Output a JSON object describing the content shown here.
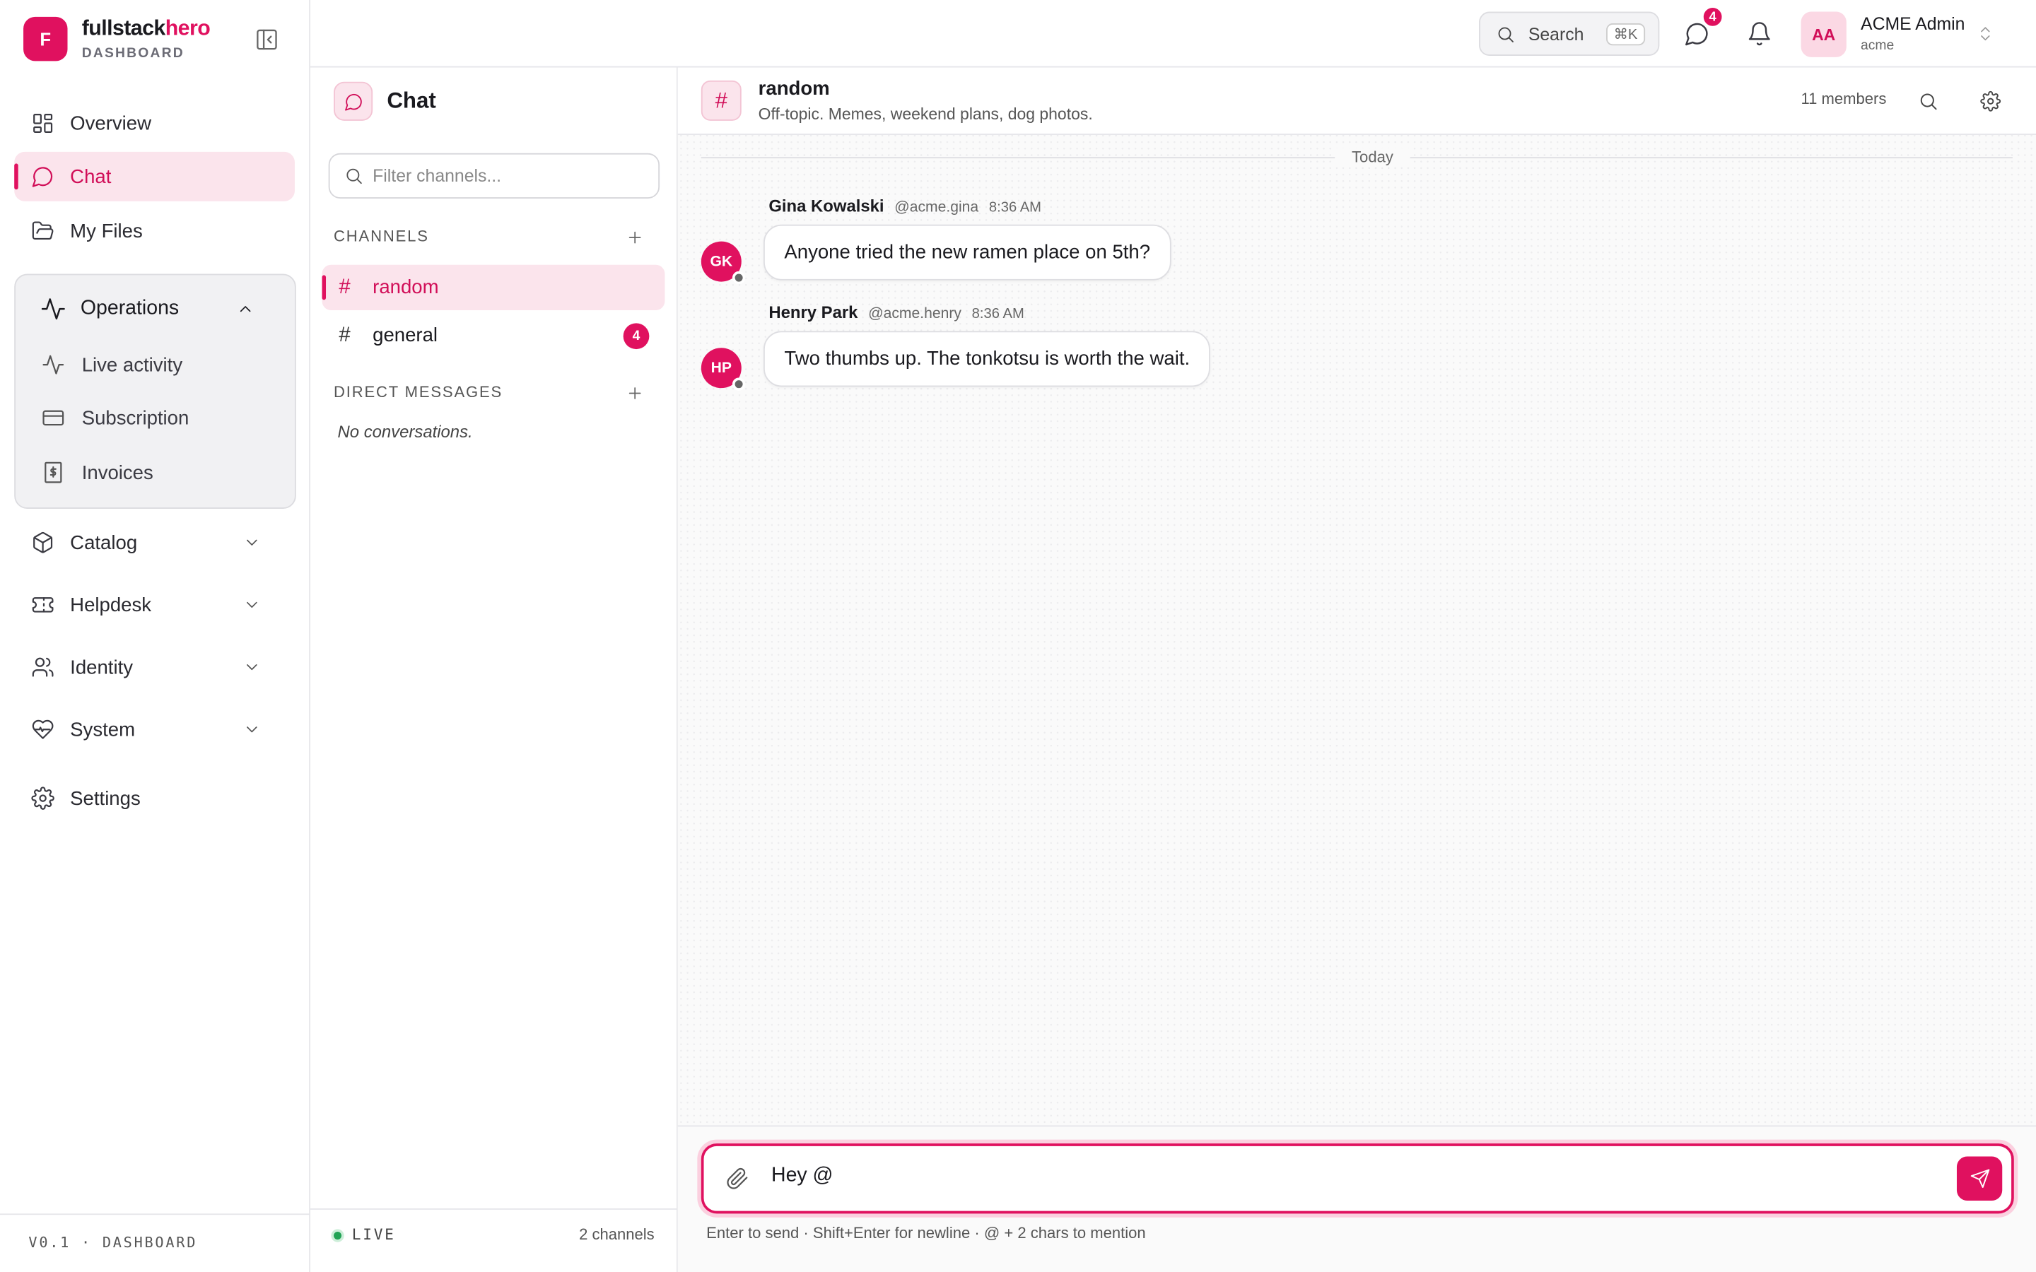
{
  "brand": {
    "logo_letter": "F",
    "name_part1": "fullstack",
    "name_part2": "hero",
    "sub": "DASHBOARD",
    "accent": "#e0115f"
  },
  "sidebar": {
    "items": [
      {
        "label": "Overview",
        "icon": "grid-icon"
      },
      {
        "label": "Chat",
        "icon": "chat-bubble-icon",
        "active": true
      },
      {
        "label": "My Files",
        "icon": "folder-icon"
      }
    ],
    "operations": {
      "label": "Operations",
      "children": [
        {
          "label": "Live activity",
          "icon": "activity-icon"
        },
        {
          "label": "Subscription",
          "icon": "credit-card-icon"
        },
        {
          "label": "Invoices",
          "icon": "invoice-icon"
        }
      ]
    },
    "groups": [
      {
        "label": "Catalog",
        "icon": "package-icon"
      },
      {
        "label": "Helpdesk",
        "icon": "ticket-icon"
      },
      {
        "label": "Identity",
        "icon": "users-icon"
      },
      {
        "label": "System",
        "icon": "heart-pulse-icon"
      }
    ],
    "settings": "Settings",
    "footer": "V0.1 · DASHBOARD"
  },
  "topbar": {
    "search_label": "Search",
    "search_shortcut": "⌘K",
    "messages_badge": "4",
    "user": {
      "initials": "AA",
      "name": "ACME Admin",
      "org": "acme"
    }
  },
  "chat_panel": {
    "title": "Chat",
    "filter_placeholder": "Filter channels...",
    "channels_label": "CHANNELS",
    "channels": [
      {
        "name": "random",
        "active": true
      },
      {
        "name": "general",
        "unread": "4"
      }
    ],
    "dm_label": "DIRECT MESSAGES",
    "dm_empty": "No conversations.",
    "live_label": "LIVE",
    "channel_count": "2 channels"
  },
  "conversation": {
    "name": "random",
    "description": "Off-topic. Memes, weekend plans, dog photos.",
    "members": "11 members",
    "day_separator": "Today",
    "messages": [
      {
        "initials": "GK",
        "author": "Gina Kowalski",
        "handle": "@acme.gina",
        "time": "8:36 AM",
        "text": "Anyone tried the new ramen place on 5th?"
      },
      {
        "initials": "HP",
        "author": "Henry Park",
        "handle": "@acme.henry",
        "time": "8:36 AM",
        "text": "Two thumbs up. The tonkotsu is worth the wait."
      }
    ],
    "composer_value": "Hey @",
    "composer_hint": "Enter to send · Shift+Enter for newline · @ + 2 chars to mention"
  }
}
